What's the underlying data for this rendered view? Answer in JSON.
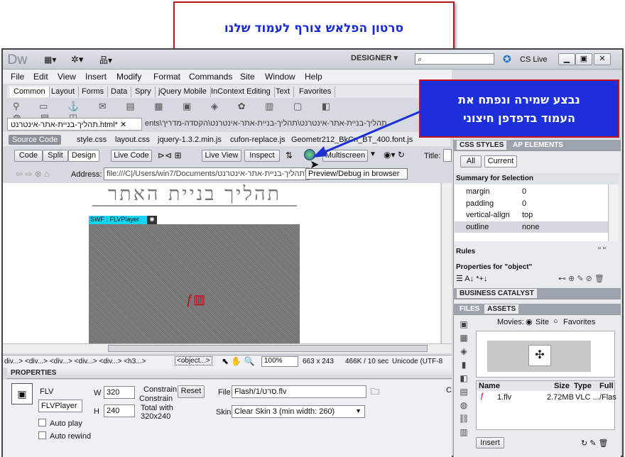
{
  "callout_top": "סרטון הפלאש צורף לעמוד שלנו",
  "callout_right": [
    "נבצע שמירה ונפתח את",
    "העמוד בדפדפן חיצוני"
  ],
  "app": {
    "logo": "Dw",
    "workspace": "DESIGNER",
    "cslive": "CS Live"
  },
  "menu": [
    "File",
    "Edit",
    "View",
    "Insert",
    "Modify",
    "Format",
    "Commands",
    "Site",
    "Window",
    "Help"
  ],
  "insert_tabs": [
    "Common",
    "Layout",
    "Forms",
    "Data",
    "Spry",
    "jQuery Mobile",
    "InContext Editing",
    "Text",
    "Favorites"
  ],
  "doc_tab": "תהליך-בניית-אתר-אינטרנט.html*",
  "path_tab": "ents\\תהליך-בניית-אתר-אינטרנט\\תהליך-בניית-אתר-אינטרנט\\הקסדה-מדריך",
  "related_files": [
    "Source Code",
    "style.css",
    "layout.css",
    "jquery-1.3.2.min.js",
    "cufon-replace.js",
    "Geometr212_BkCn_BT_400.font.js"
  ],
  "doc_toolbar": {
    "code": "Code",
    "split": "Split",
    "design": "Design",
    "live_code": "Live Code",
    "live_view": "Live View",
    "inspect": "Inspect",
    "multiscreen": "Multiscreen",
    "title_label": "Title:"
  },
  "address": {
    "label": "Address:",
    "value": "file:///C|/Users/win7/Documents/תהליך-בניית-אתר-אינטרנט\\"
  },
  "tooltip": "Preview/Debug in browser",
  "page_heading": "תהליך בניית האתר",
  "swf_label": "SWF : FLVPlayer",
  "status": {
    "tags": "div...> <div...> <div...> <div...> <div...> <h3...>",
    "selected_tag": "<object...>",
    "zoom": "100%",
    "size": "663 x 243",
    "weight": "466K / 10 sec",
    "encoding": "Unicode (UTF-8"
  },
  "properties": {
    "header": "PROPERTIES",
    "type": "FLV",
    "name": "FLVPlayer",
    "w_label": "W",
    "w": "320",
    "h_label": "H",
    "h": "240",
    "constrain": "Constrain",
    "constrain2": "Constrain",
    "total": "Total with",
    "total_size": "320x240",
    "reset": "Reset",
    "file_label": "File",
    "file": "Flash/1/סרט.flv",
    "skin_label": "Skin",
    "skin": "Clear Skin 3 (min width: 260)",
    "autoplay": "Auto play",
    "autorewind": "Auto rewind",
    "c": "C"
  },
  "css_panel": {
    "tab1": "CSS STYLES",
    "tab2": "AP ELEMENTS",
    "all": "All",
    "current": "Current",
    "summary": "Summary for Selection",
    "props": [
      {
        "name": "margin",
        "value": "0"
      },
      {
        "name": "padding",
        "value": "0"
      },
      {
        "name": "vertical-align",
        "value": "top"
      },
      {
        "name": "outline",
        "value": "none"
      }
    ],
    "rules": "Rules",
    "props_for": "Properties for \"object\""
  },
  "bc": "BUSINESS CATALYST",
  "assets": {
    "tab1": "FILES",
    "tab2": "ASSETS",
    "movies": "Movies:",
    "site": "Site",
    "favorites": "Favorites",
    "cols": [
      "Name",
      "Size",
      "Type",
      "Full"
    ],
    "row": {
      "name": "1.flv",
      "size": "2.72MB",
      "type": "VLC ...",
      "full": "/Flas"
    },
    "insert": "Insert"
  }
}
